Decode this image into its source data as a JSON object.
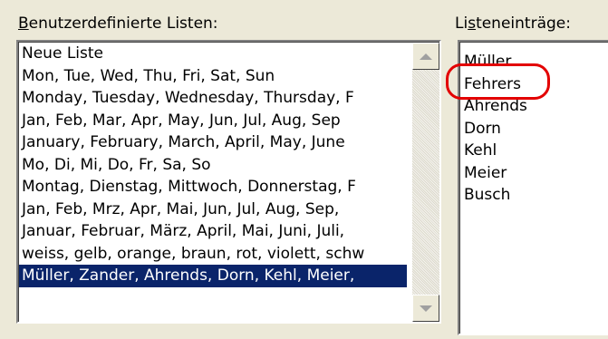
{
  "custom_lists": {
    "label_prefix": "B",
    "label_rest": "enutzerdefinierte Listen:",
    "items": [
      "Neue Liste",
      "Mon, Tue, Wed, Thu, Fri, Sat, Sun",
      "Monday, Tuesday, Wednesday, Thursday, F",
      "Jan, Feb, Mar, Apr, May, Jun, Jul, Aug, Sep",
      "January, February, March, April, May, June",
      "Mo, Di, Mi, Do, Fr, Sa, So",
      "Montag, Dienstag, Mittwoch, Donnerstag, F",
      "Jan, Feb, Mrz, Apr, Mai, Jun, Jul, Aug, Sep,",
      "Januar, Februar, März, April, Mai, Juni, Juli,",
      "weiss, gelb, orange, braun, rot, violett, schw",
      "Müller, Zander, Ahrends, Dorn, Kehl, Meier,"
    ]
  },
  "list_entries": {
    "label_prefix": "Li",
    "label_ul": "s",
    "label_rest": "teneinträge:",
    "items": [
      "Müller",
      "Fehrers",
      "Ahrends",
      "Dorn",
      "Kehl",
      "Meier",
      "Busch"
    ]
  },
  "colors": {
    "selection": "#0a246a",
    "annotation": "#e30000"
  }
}
